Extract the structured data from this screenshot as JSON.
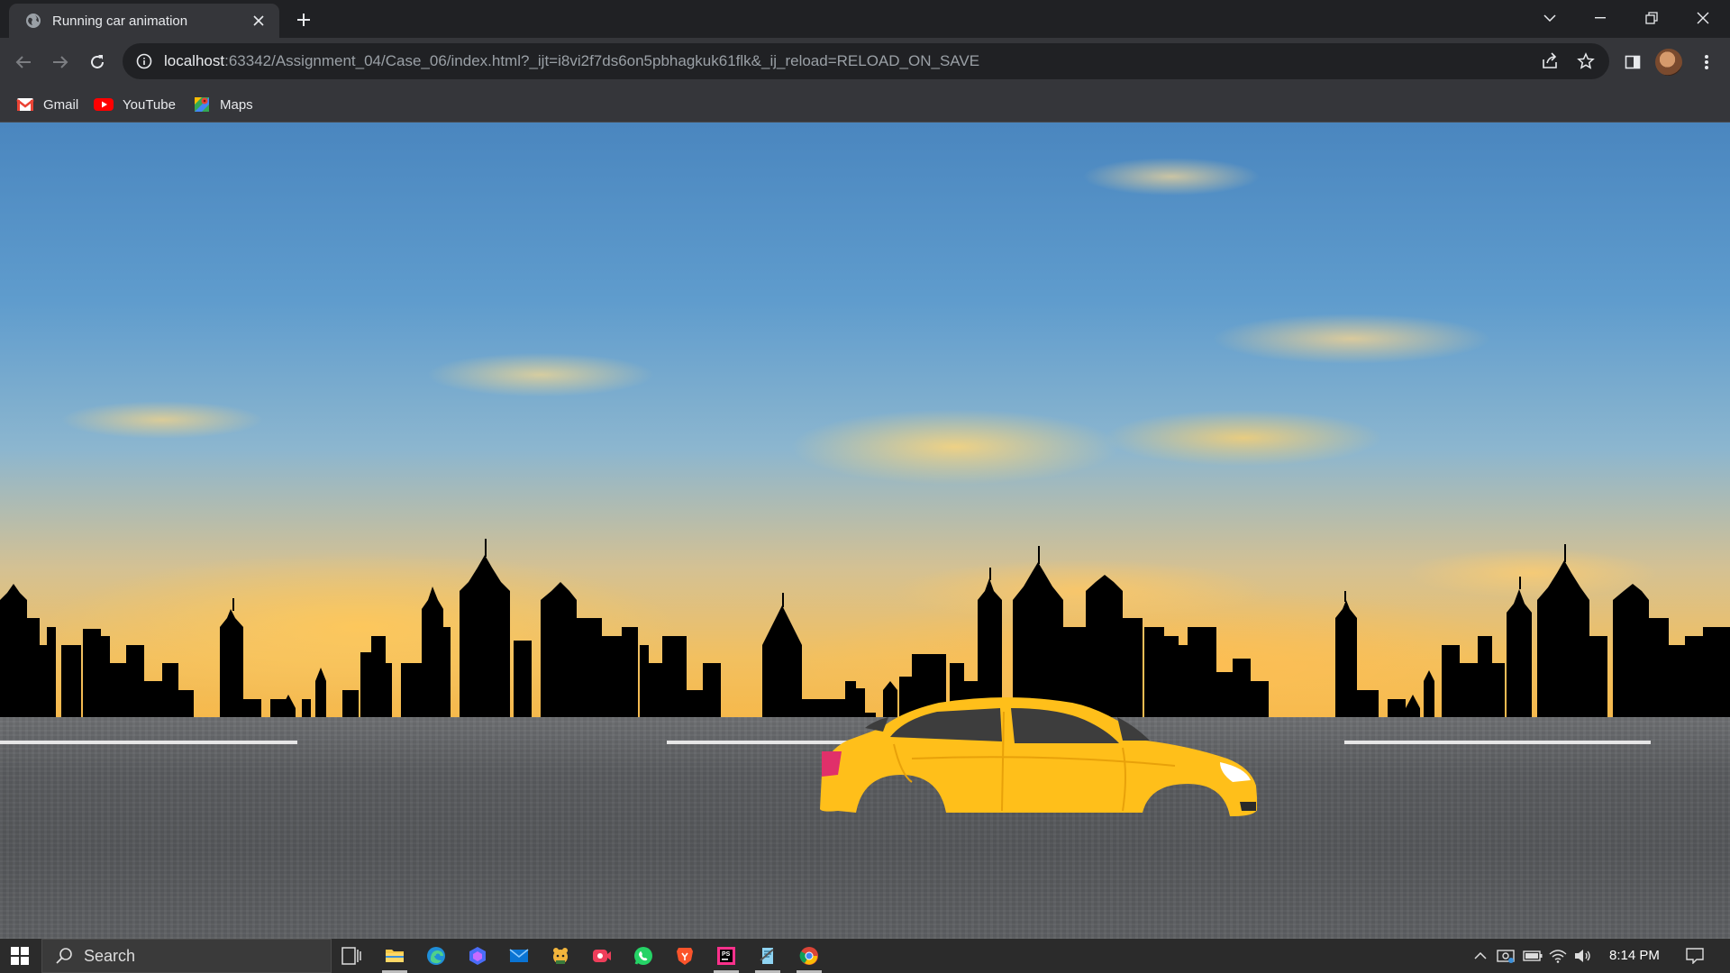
{
  "browser": {
    "tab": {
      "title": "Running car animation"
    },
    "address_bar": {
      "host": "localhost",
      "path": ":63342/Assignment_04/Case_06/index.html?_ijt=i8vi2f7ds6on5pbhagkuk61flk&_ij_reload=RELOAD_ON_SAVE"
    },
    "bookmarks": [
      {
        "label": "Gmail",
        "icon": "gmail-icon"
      },
      {
        "label": "YouTube",
        "icon": "youtube-icon"
      },
      {
        "label": "Maps",
        "icon": "maps-icon"
      }
    ]
  },
  "page": {
    "scene": {
      "car_color": "#ffbf1a",
      "window_color": "#3d3d3d",
      "sky_top_color": "#4a86bf",
      "horizon_color": "#f6b94c",
      "road_color": "#5b5d60",
      "lane_color": "#e6e6e6"
    }
  },
  "taskbar": {
    "search_placeholder": "Search",
    "clock": "8:14 PM",
    "apps": [
      "task-view-icon",
      "file-explorer-icon",
      "edge-icon",
      "copilot-icon",
      "mail-icon",
      "pets-app-icon",
      "screen-recorder-icon",
      "whatsapp-icon",
      "brave-icon",
      "jetbrains-icon",
      "notepad-icon",
      "chrome-icon"
    ]
  }
}
